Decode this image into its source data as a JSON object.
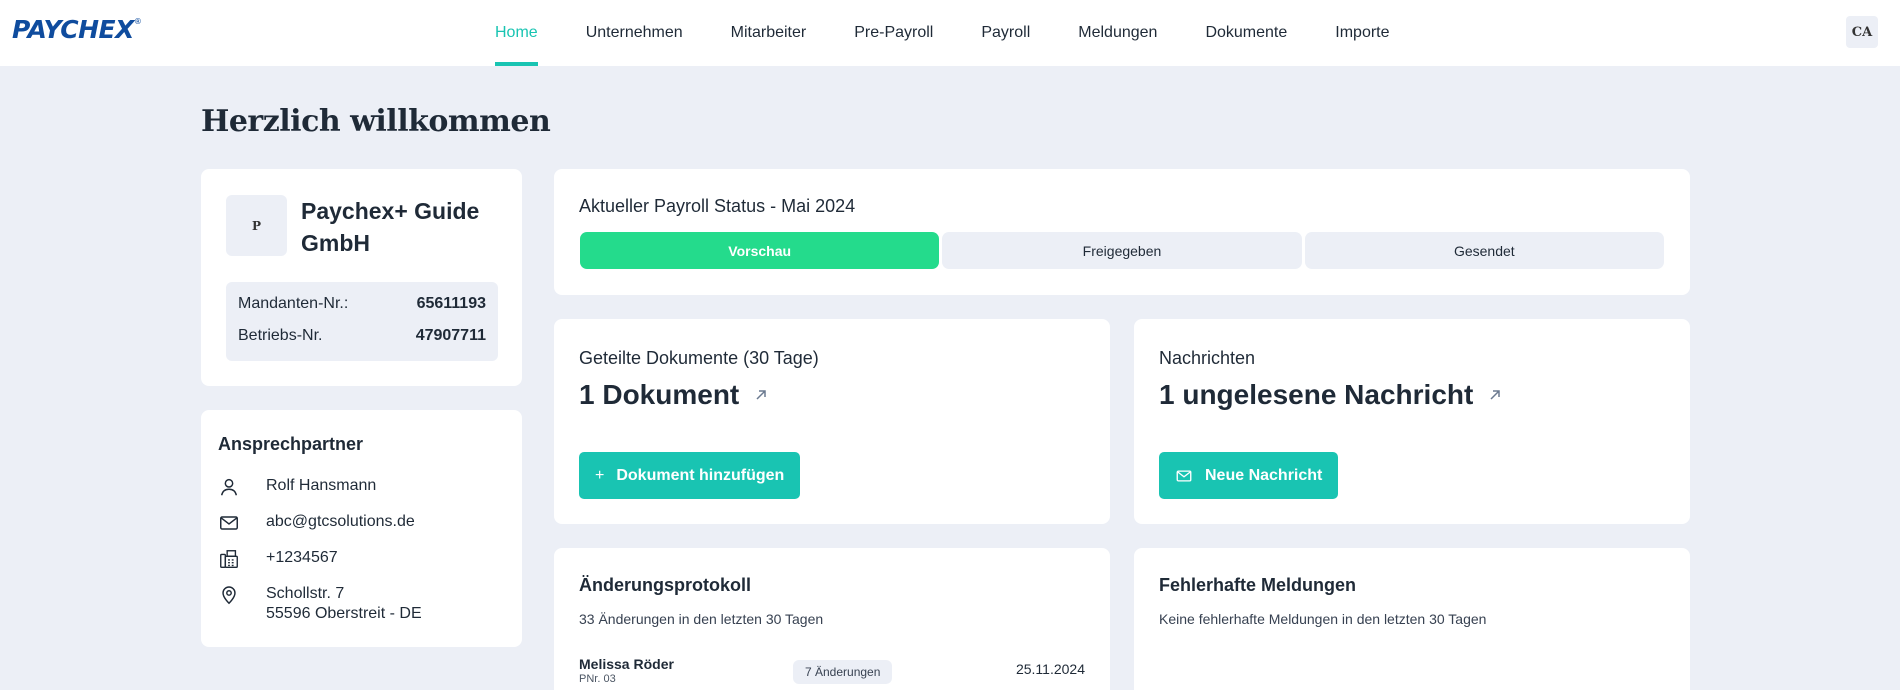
{
  "header": {
    "logo_text": "PAYCHEX",
    "logo_mark": "®",
    "nav": [
      {
        "label": "Home",
        "active": true
      },
      {
        "label": "Unternehmen"
      },
      {
        "label": "Mitarbeiter"
      },
      {
        "label": "Pre-Payroll"
      },
      {
        "label": "Payroll"
      },
      {
        "label": "Meldungen"
      },
      {
        "label": "Dokumente"
      },
      {
        "label": "Importe"
      }
    ],
    "user_initials": "CA"
  },
  "page": {
    "title": "Herzlich willkommen"
  },
  "company": {
    "logo_letter": "P",
    "name": "Paychex+ Guide GmbH",
    "rows": [
      {
        "label": "Mandanten-Nr.:",
        "value": "65611193"
      },
      {
        "label": "Betriebs-Nr.",
        "value": "47907711"
      }
    ]
  },
  "contact": {
    "title": "Ansprechpartner",
    "name": "Rolf Hansmann",
    "email": "abc@gtcsolutions.de",
    "phone": "+1234567",
    "address_line1": "Schollstr. 7",
    "address_line2": "55596 Oberstreit - DE"
  },
  "payroll_status": {
    "title": "Aktueller Payroll Status - Mai 2024",
    "steps": [
      {
        "label": "Vorschau",
        "active": true
      },
      {
        "label": "Freigegeben"
      },
      {
        "label": "Gesendet"
      }
    ]
  },
  "documents": {
    "title": "Geteilte Dokumente (30 Tage)",
    "count_text": "1 Dokument",
    "button_icon": "+",
    "button_label": "Dokument hinzufügen"
  },
  "messages": {
    "title": "Nachrichten",
    "count_text": "1 ungelesene Nachricht",
    "button_label": "Neue Nachricht"
  },
  "changelog": {
    "title": "Änderungsprotokoll",
    "subtitle": "33 Änderungen in den letzten 30 Tagen",
    "entries": [
      {
        "name": "Melissa Röder",
        "pnr": "PNr. 03",
        "badge": "7 Änderungen",
        "date": "25.11.2024"
      }
    ]
  },
  "errors": {
    "title": "Fehlerhafte Meldungen",
    "subtitle": "Keine fehlerhafte Meldungen in den letzten 30 Tagen"
  },
  "colors": {
    "accent": "#19c4b2",
    "status_active": "#24db8c",
    "logo_blue": "#0f4c9e",
    "page_bg": "#eceff6"
  },
  "icons": {
    "external": "arrow-up-right-icon",
    "person": "person-icon",
    "mail": "mail-icon",
    "phone": "fax-phone-icon",
    "location": "location-pin-icon"
  }
}
